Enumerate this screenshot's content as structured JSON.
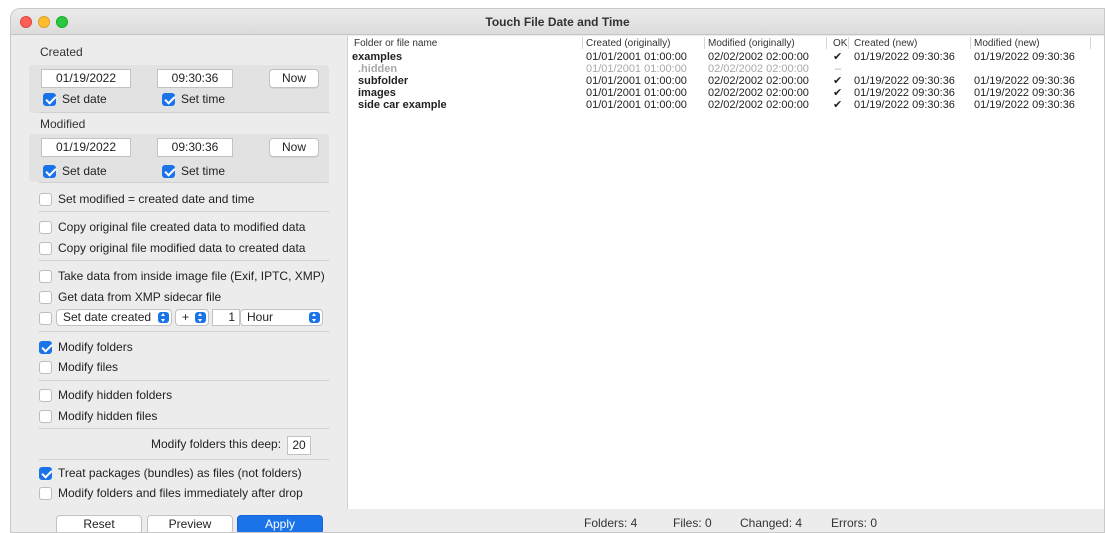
{
  "window": {
    "title": "Touch File Date and Time"
  },
  "created": {
    "label": "Created",
    "date": "01/19/2022",
    "time": "09:30:36",
    "now_label": "Now",
    "set_date_label": "Set date",
    "set_time_label": "Set time"
  },
  "modified": {
    "label": "Modified",
    "date": "01/19/2022",
    "time": "09:30:36",
    "now_label": "Now",
    "set_date_label": "Set date",
    "set_time_label": "Set time"
  },
  "options": {
    "set_modified_equals_created": {
      "label": "Set modified = created date and time",
      "checked": false
    },
    "copy_created_to_modified": {
      "label": "Copy original file created data to modified data",
      "checked": false
    },
    "copy_modified_to_created": {
      "label": "Copy original file modified data to created data",
      "checked": false
    },
    "take_data_from_image": {
      "label": "Take data from inside image file (Exif, IPTC, XMP)",
      "checked": false
    },
    "get_data_from_xmp": {
      "label": "Get data from XMP sidecar file",
      "checked": false
    },
    "offset": {
      "checked": false,
      "mode": "Set date created",
      "sign": "+",
      "amount": "1",
      "unit": "Hour"
    },
    "modify_folders": {
      "label": "Modify folders",
      "checked": true
    },
    "modify_files": {
      "label": "Modify files",
      "checked": false
    },
    "modify_hidden_folders": {
      "label": "Modify hidden folders",
      "checked": false
    },
    "modify_hidden_files": {
      "label": "Modify hidden files",
      "checked": false
    },
    "depth": {
      "label": "Modify folders this deep:",
      "value": "20"
    },
    "treat_packages": {
      "label": "Treat packages (bundles) as files (not folders)",
      "checked": true
    },
    "modify_after_drop": {
      "label": "Modify folders and files immediately after drop",
      "checked": false
    }
  },
  "buttons": {
    "reset": "Reset",
    "preview": "Preview",
    "apply": "Apply"
  },
  "table": {
    "columns": [
      "Folder or file name",
      "Created (originally)",
      "Modified (originally)",
      "OK",
      "Created (new)",
      "Modified (new)"
    ],
    "rows": [
      {
        "name": "examples",
        "created_orig": "01/01/2001  01:00:00",
        "modified_orig": "02/02/2002  02:00:00",
        "ok": "✔",
        "created_new": "01/19/2022  09:30:36",
        "modified_new": "01/19/2022  09:30:36",
        "dim": false,
        "indent": 0
      },
      {
        "name": ".hidden",
        "created_orig": "01/01/2001  01:00:00",
        "modified_orig": "02/02/2002  02:00:00",
        "ok": "–",
        "created_new": "",
        "modified_new": "",
        "dim": true,
        "indent": 1
      },
      {
        "name": "subfolder",
        "created_orig": "01/01/2001  01:00:00",
        "modified_orig": "02/02/2002  02:00:00",
        "ok": "✔",
        "created_new": "01/19/2022  09:30:36",
        "modified_new": "01/19/2022  09:30:36",
        "dim": false,
        "indent": 1
      },
      {
        "name": "images",
        "created_orig": "01/01/2001  01:00:00",
        "modified_orig": "02/02/2002  02:00:00",
        "ok": "✔",
        "created_new": "01/19/2022  09:30:36",
        "modified_new": "01/19/2022  09:30:36",
        "dim": false,
        "indent": 1
      },
      {
        "name": "side car example",
        "created_orig": "01/01/2001  01:00:00",
        "modified_orig": "02/02/2002  02:00:00",
        "ok": "✔",
        "created_new": "01/19/2022  09:30:36",
        "modified_new": "01/19/2022  09:30:36",
        "dim": false,
        "indent": 1
      }
    ]
  },
  "status": {
    "folders": "Folders:  4",
    "files": "Files: 0",
    "changed": "Changed: 4",
    "errors": "Errors: 0"
  },
  "colors": {
    "accent": "#1a73e8",
    "close": "#fe5f57",
    "minimize": "#febc2e",
    "maximize": "#28c840"
  }
}
